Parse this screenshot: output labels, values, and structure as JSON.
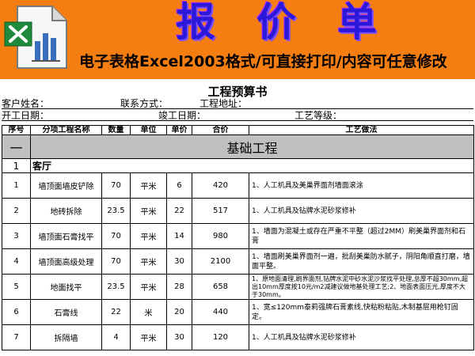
{
  "banner": {
    "title": "报价单",
    "subtitle": "电子表格Excel2003格式/可直接打印/内容可任意修改",
    "logo_icon": "excel-icon"
  },
  "sheet": {
    "title": "工程预算书",
    "customer_label": "客户姓名：",
    "contact_label": "联系方式：",
    "address_label": "工程地址：",
    "start_label": "开工日期：",
    "end_label": "竣工日期：",
    "level_label": "工艺等级："
  },
  "table": {
    "headers": [
      "序号",
      "分项工程名称",
      "数量",
      "单位",
      "单价",
      "合价",
      "工艺做法"
    ],
    "section": {
      "no": "一",
      "name": "基础工程"
    },
    "subsection": {
      "no": "1",
      "name": "客厅"
    },
    "rows": [
      {
        "no": "1",
        "name": "墙顶面墙皮铲除",
        "qty": "70",
        "unit": "平米",
        "price": "6",
        "total": "420",
        "method": "1、人工机具及美巢界面剂墙面滚涂"
      },
      {
        "no": "2",
        "name": "地砖拆除",
        "qty": "23.5",
        "unit": "平米",
        "price": "22",
        "total": "517",
        "method": "1、人工机具及钻牌水泥砂浆修补"
      },
      {
        "no": "3",
        "name": "墙顶面石膏找平",
        "qty": "70",
        "unit": "平米",
        "price": "14",
        "total": "980",
        "method": "1、墙面为混凝土或存在严重不平整（超过2MM）刷美巢界面剂和石膏"
      },
      {
        "no": "4",
        "name": "墙顶面高级处理",
        "qty": "70",
        "unit": "平米",
        "price": "30",
        "total": "2100",
        "method": "1、墙面刷美巢界面剂一遍，批刮美巢防水腻子，阴阳角顺直打磨，墙面平整。"
      },
      {
        "no": "5",
        "name": "地面找平",
        "qty": "23.5",
        "unit": "平米",
        "price": "28",
        "total": "658",
        "method": "1、原地面清理,刷界面剂,钻牌水泥中砂水泥沙浆找平处理,总厚不超30mm,超出10mm厚度按10元/m2减建议做地基处理工艺;2、地面表面压光,厚度不大于30mm。"
      },
      {
        "no": "6",
        "name": "石膏线",
        "qty": "22",
        "unit": "米",
        "price": "20",
        "total": "440",
        "method": "1、宽≤120mm泰莉强牌石膏素线,快粘粉粘贴,木制基层用枪钉固定。"
      },
      {
        "no": "7",
        "name": "拆隔墙",
        "qty": "4",
        "unit": "平米",
        "price": "30",
        "total": "120",
        "method": "1、人工机具及钻牌水泥砂浆修补"
      }
    ]
  }
}
